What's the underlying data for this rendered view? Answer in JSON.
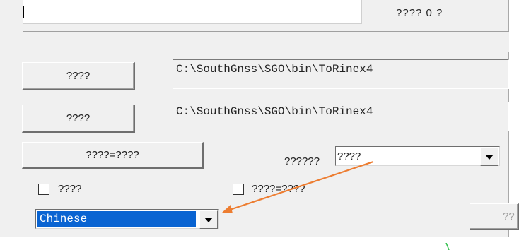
{
  "header": {
    "status_text": "???? 0 ?"
  },
  "paths": {
    "button1_label": "????",
    "path1_value": "C:\\SouthGnss\\SGO\\bin\\ToRinex4",
    "button2_label": "????",
    "path2_value": "C:\\SouthGnss\\SGO\\bin\\ToRinex4"
  },
  "actions": {
    "convert_button_label": "????=????",
    "right_button_label": "??"
  },
  "mode": {
    "label": "??????",
    "selected": "????"
  },
  "options": {
    "checkbox1_label": "????",
    "checkbox1_checked": false,
    "checkbox2_label": "????=????",
    "checkbox2_checked": false
  },
  "language": {
    "selected": "Chinese"
  },
  "colors": {
    "annotation_arrow": "#ed7d31",
    "selection_highlight": "#0a64d2"
  }
}
